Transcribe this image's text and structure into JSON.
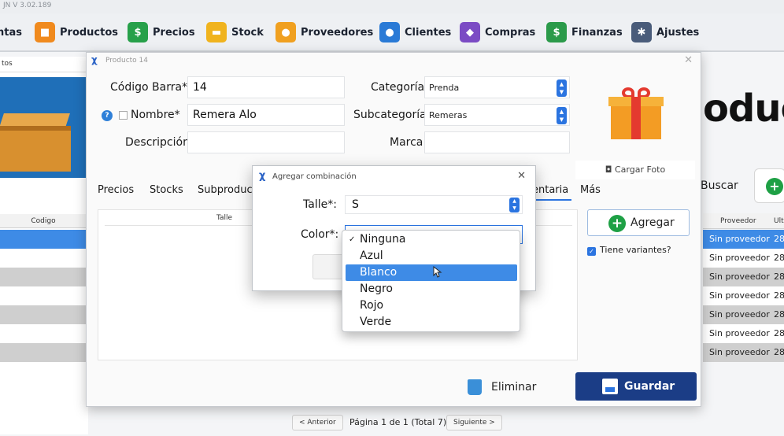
{
  "window": {
    "title": "JN V 3.02.189"
  },
  "menubar": {
    "items": [
      {
        "label": "ntas",
        "icon": "sales-icon",
        "color": "#e25b3a"
      },
      {
        "label": "Productos",
        "icon": "gift-icon",
        "color": "#f08a1e"
      },
      {
        "label": "Precios",
        "icon": "price-tag-icon",
        "color": "#27a04a"
      },
      {
        "label": "Stock",
        "icon": "cart-icon",
        "color": "#f0b31e"
      },
      {
        "label": "Proveedores",
        "icon": "supplier-person-icon",
        "color": "#f0a020"
      },
      {
        "label": "Clientes",
        "icon": "client-person-icon",
        "color": "#2a7ad6"
      },
      {
        "label": "Compras",
        "icon": "purchases-icon",
        "color": "#7b4bc4"
      },
      {
        "label": "Finanzas",
        "icon": "money-bag-icon",
        "color": "#2b9a4a"
      },
      {
        "label": "Ajustes",
        "icon": "gear-icon",
        "color": "#4a5c7a"
      }
    ]
  },
  "background": {
    "left_tab": "tos",
    "left_column_header": "Codigo",
    "big_word": "oduct",
    "buscar": "Buscar",
    "right_headers": {
      "proveedor": "Proveedor",
      "ult": "Ult"
    },
    "right_rows": [
      {
        "proveedor": "Sin proveedor",
        "ult": "28"
      },
      {
        "proveedor": "Sin proveedor",
        "ult": "28"
      },
      {
        "proveedor": "Sin proveedor",
        "ult": "28"
      },
      {
        "proveedor": "Sin proveedor",
        "ult": "28"
      },
      {
        "proveedor": "Sin proveedor",
        "ult": "28"
      },
      {
        "proveedor": "Sin proveedor",
        "ult": "28"
      },
      {
        "proveedor": "Sin proveedor",
        "ult": "28"
      }
    ],
    "pager": {
      "prev": "< Anterior",
      "text": "Página 1 de 1 (Total 7)",
      "next": "Siguiente >"
    }
  },
  "producto_dialog": {
    "title": "Producto 14",
    "labels": {
      "codigo": "Código Barra*",
      "nombre": "Nombre*",
      "descripcion": "Descripción",
      "categoria": "Categoría",
      "subcategoria": "Subcategoría",
      "marca": "Marca"
    },
    "values": {
      "codigo": "14",
      "nombre": "Remera Alo",
      "descripcion": "",
      "categoria": "Prenda",
      "subcategoria": "Remeras",
      "marca": ""
    },
    "cargar_foto": "Cargar Foto",
    "tabs": [
      "Precios",
      "Stocks",
      "Subproduc",
      "entaria",
      "Más"
    ],
    "table_header": "Talle",
    "agregar": "Agregar",
    "tiene_variantes": "Tiene variantes?",
    "eliminar": "Eliminar",
    "guardar": "Guardar"
  },
  "combo_dialog": {
    "title": "Agregar combinación",
    "talle_label": "Talle*:",
    "talle_value": "S",
    "color_label": "Color*:",
    "color_options": [
      {
        "label": "Ninguna",
        "checked": true,
        "highlighted": false
      },
      {
        "label": "Azul",
        "checked": false,
        "highlighted": false
      },
      {
        "label": "Blanco",
        "checked": false,
        "highlighted": true
      },
      {
        "label": "Negro",
        "checked": false,
        "highlighted": false
      },
      {
        "label": "Rojo",
        "checked": false,
        "highlighted": false
      },
      {
        "label": "Verde",
        "checked": false,
        "highlighted": false
      }
    ]
  }
}
